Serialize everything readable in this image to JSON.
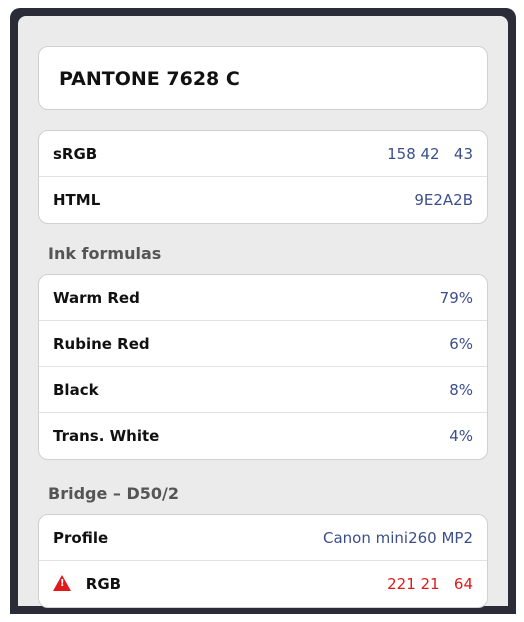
{
  "header": {
    "title": "PANTONE 7628 C"
  },
  "color_values": [
    {
      "label": "sRGB",
      "value": "158 42   43"
    },
    {
      "label": "HTML",
      "value": "9E2A2B"
    }
  ],
  "ink_formulas": {
    "heading": "Ink formulas",
    "rows": [
      {
        "label": "Warm Red",
        "value": "79%"
      },
      {
        "label": "Rubine Red",
        "value": "6%"
      },
      {
        "label": "Black",
        "value": "8%"
      },
      {
        "label": "Trans. White",
        "value": "4%"
      }
    ]
  },
  "bridge": {
    "heading": "Bridge – D50/2",
    "profile": {
      "label": "Profile",
      "value": "Canon mini260 MP2"
    },
    "rgb": {
      "label": "RGB",
      "value": "221 21   64",
      "warning_icon": "warning-triangle-icon",
      "warning_color": "#e01a1a"
    }
  },
  "colors": {
    "accent": "#3c4f8c",
    "warning": "#e01a1a",
    "frame": "#2a2c38"
  }
}
